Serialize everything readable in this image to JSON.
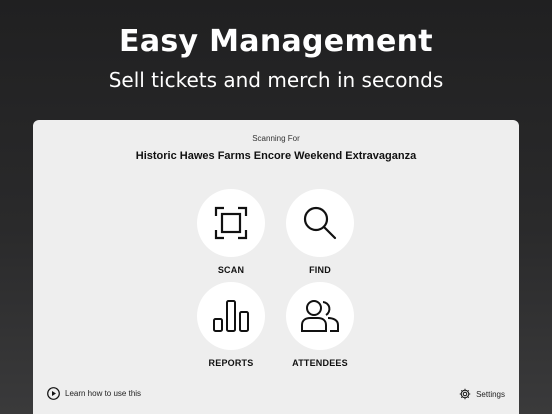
{
  "hero": {
    "title": "Easy Management",
    "subtitle": "Sell tickets and merch in seconds"
  },
  "panel": {
    "scanning_for_label": "Scanning For",
    "event_name": "Historic Hawes Farms Encore Weekend Extravaganza",
    "actions": [
      {
        "label": "SCAN",
        "icon": "scan-frame-icon"
      },
      {
        "label": "FIND",
        "icon": "magnifier-icon"
      },
      {
        "label": "REPORTS",
        "icon": "bar-chart-icon"
      },
      {
        "label": "ATTENDEES",
        "icon": "people-icon"
      }
    ],
    "footer": {
      "learn_label": "Learn how to use this",
      "settings_label": "Settings"
    }
  },
  "colors": {
    "background": "#2a2a2b",
    "panel": "#eeeeee",
    "circle": "#ffffff",
    "text_dark": "#111111"
  }
}
